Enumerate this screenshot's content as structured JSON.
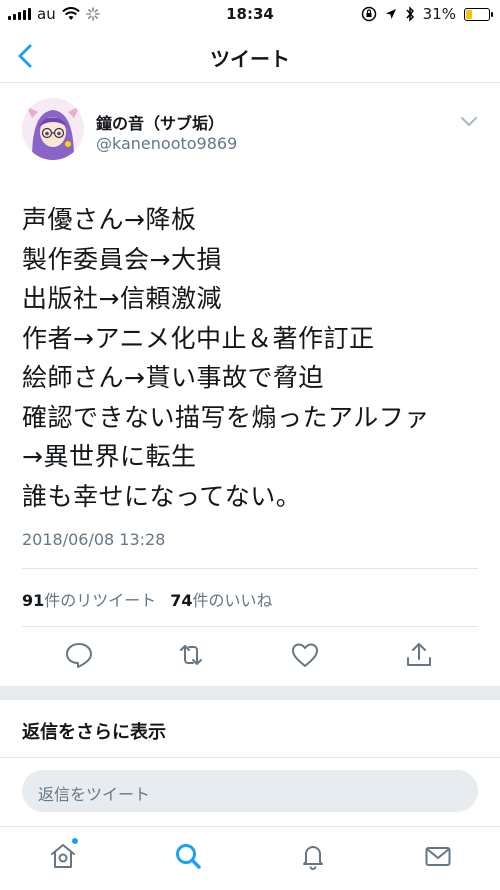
{
  "status_bar": {
    "carrier": "au",
    "time": "18:34",
    "battery_percent": "31%",
    "battery_level": 0.31
  },
  "nav": {
    "title": "ツイート"
  },
  "author": {
    "name": "鐘の音（サブ垢）",
    "handle": "@kanenooto9869"
  },
  "tweet": {
    "lines": [
      "声優さん→降板",
      "製作委員会→大損",
      "出版社→信頼激減",
      "作者→アニメ化中止＆著作訂正",
      "絵師さん→貰い事故で脅迫",
      "確認できない描写を煽ったアルファ",
      "→異世界に転生",
      "誰も幸せになってない。"
    ],
    "timestamp": "2018/06/08 13:28"
  },
  "stats": {
    "retweets_count": "91",
    "retweets_label": "件のリツイート",
    "likes_count": "74",
    "likes_label": "件のいいね"
  },
  "replies": {
    "show_more": "返信をさらに表示",
    "reply_placeholder": "返信をツイート"
  },
  "icons": {
    "accent": "#1da1f2",
    "muted": "#657786"
  }
}
